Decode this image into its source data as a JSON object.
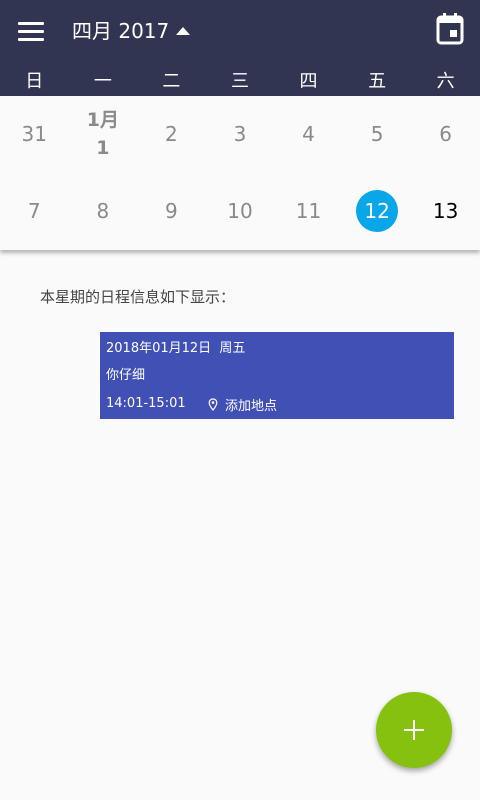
{
  "header": {
    "month_title": "四月 2017",
    "icons": {
      "menu": "menu-icon",
      "collapse": "triangle-up-icon",
      "today": "calendar-today-icon"
    },
    "colors": {
      "bar": "#313552",
      "text": "#ffffff"
    }
  },
  "weekdays": [
    "日",
    "一",
    "二",
    "三",
    "四",
    "五",
    "六"
  ],
  "calendar": {
    "week1": [
      {
        "label": "31"
      },
      {
        "line1": "1月",
        "line2": "1"
      },
      {
        "label": "2"
      },
      {
        "label": "3"
      },
      {
        "label": "4"
      },
      {
        "label": "5"
      },
      {
        "label": "6"
      }
    ],
    "week2": [
      {
        "label": "7"
      },
      {
        "label": "8"
      },
      {
        "label": "9"
      },
      {
        "label": "10"
      },
      {
        "label": "11"
      },
      {
        "label": "12",
        "selected": true
      },
      {
        "label": "13"
      }
    ],
    "colors": {
      "selected": "#0aa6ea",
      "muted": "#8a8a8a"
    }
  },
  "schedule": {
    "intro_text": "本星期的日程信息如下显示：",
    "events": [
      {
        "date_line": "2018年01月12日  周五",
        "title": "你仔细",
        "time": "14:01-15:01",
        "location": "添加地点",
        "color": "#4050b5"
      }
    ]
  },
  "fab": {
    "icon": "plus-icon",
    "color": "#86c10f"
  }
}
